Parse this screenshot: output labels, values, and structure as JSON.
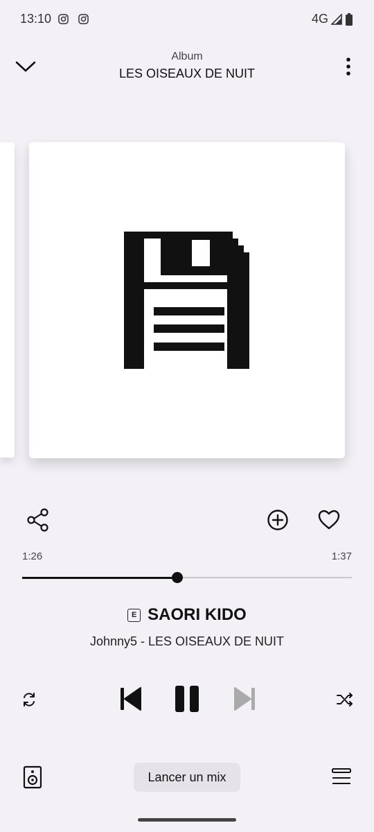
{
  "status": {
    "time": "13:10",
    "network": "4G",
    "icons": [
      "instagram-icon",
      "instagram-icon",
      "signal-icon",
      "battery-icon"
    ]
  },
  "header": {
    "label": "Album",
    "title": "LES OISEAUX DE NUIT",
    "icons": [
      "chevron-down-icon",
      "more-vertical-icon"
    ]
  },
  "artwork": {
    "icon": "floppy-disk-icon"
  },
  "actions": {
    "icons": [
      "share-icon",
      "add-circle-icon",
      "heart-icon"
    ]
  },
  "progress": {
    "current": "1:26",
    "total": "1:37",
    "fraction": 0.47
  },
  "track": {
    "explicit": "E",
    "title": "SAORI KIDO",
    "subtitle": "Johnny5 - LES OISEAUX DE NUIT"
  },
  "controls": {
    "icons": [
      "repeat-icon",
      "skip-previous-icon",
      "pause-icon",
      "skip-next-icon",
      "shuffle-icon"
    ]
  },
  "bottom": {
    "mix_label": "Lancer un mix",
    "icons": [
      "speaker-icon",
      "queue-icon"
    ]
  }
}
